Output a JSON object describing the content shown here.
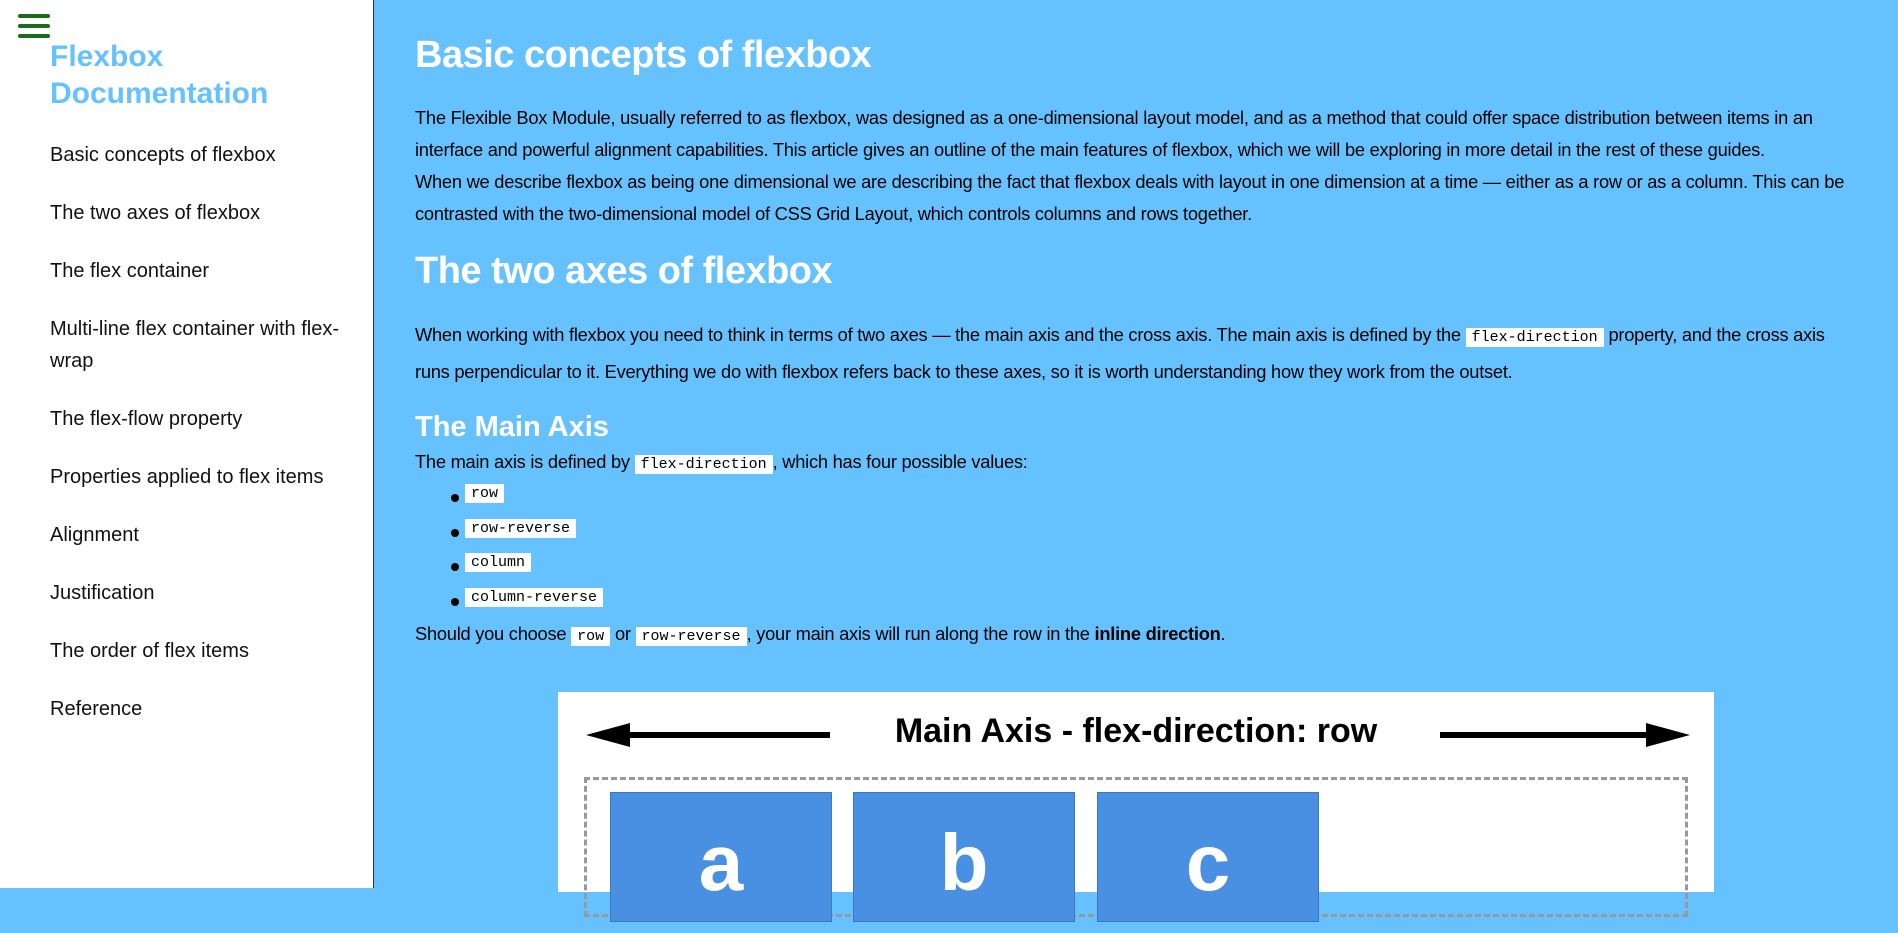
{
  "sidebar": {
    "title": "Flexbox Documentation",
    "items": [
      {
        "label": "Basic concepts of flexbox"
      },
      {
        "label": "The two axes of flexbox"
      },
      {
        "label": "The flex container"
      },
      {
        "label": "Multi-line flex container with flex-wrap"
      },
      {
        "label": "The flex-flow property"
      },
      {
        "label": "Properties applied to flex items"
      },
      {
        "label": "Alignment"
      },
      {
        "label": "Justification"
      },
      {
        "label": "The order of flex items"
      },
      {
        "label": "Reference"
      }
    ]
  },
  "main": {
    "h1_basic": "Basic concepts of flexbox",
    "p1": "The Flexible Box Module, usually referred to as flexbox, was designed as a one-dimensional layout model, and as a method that could offer space distribution between items in an interface and powerful alignment capabilities. This article gives an outline of the main features of flexbox, which we will be exploring in more detail in the rest of these guides.",
    "p2": "When we describe flexbox as being one dimensional we are describing the fact that flexbox deals with layout in one dimension at a time — either as a row or as a column. This can be contrasted with the two-dimensional model of CSS Grid Layout, which controls columns and rows together.",
    "h1_axes": "The two axes of flexbox",
    "p3_a": "When working with flexbox you need to think in terms of two axes — the main axis and the cross axis. The main axis is defined by the ",
    "p3_code": "flex-direction",
    "p3_b": " property, and the cross axis runs perpendicular to it. Everything we do with flexbox refers back to these axes, so it is worth understanding how they work from the outset.",
    "h2_main_axis": "The Main Axis",
    "p4_a": "The main axis is defined by ",
    "p4_code": "flex-direction",
    "p4_b": ", which has four possible values:",
    "values": [
      "row",
      "row-reverse",
      "column",
      "column-reverse"
    ],
    "p5_a": "Should you choose ",
    "p5_code1": "row",
    "p5_mid": " or ",
    "p5_code2": "row-reverse",
    "p5_b": ", your main axis will run along the row in the ",
    "p5_bold": "inline direction",
    "p5_end": "."
  },
  "diagram": {
    "title": "Main Axis - flex-direction: row",
    "items": [
      "a",
      "b",
      "c"
    ]
  },
  "colors": {
    "background": "#66c2ff",
    "sidebar_title": "#66c2ff",
    "hamburger": "#1a6b1a",
    "flex_item": "#4a90e2"
  }
}
